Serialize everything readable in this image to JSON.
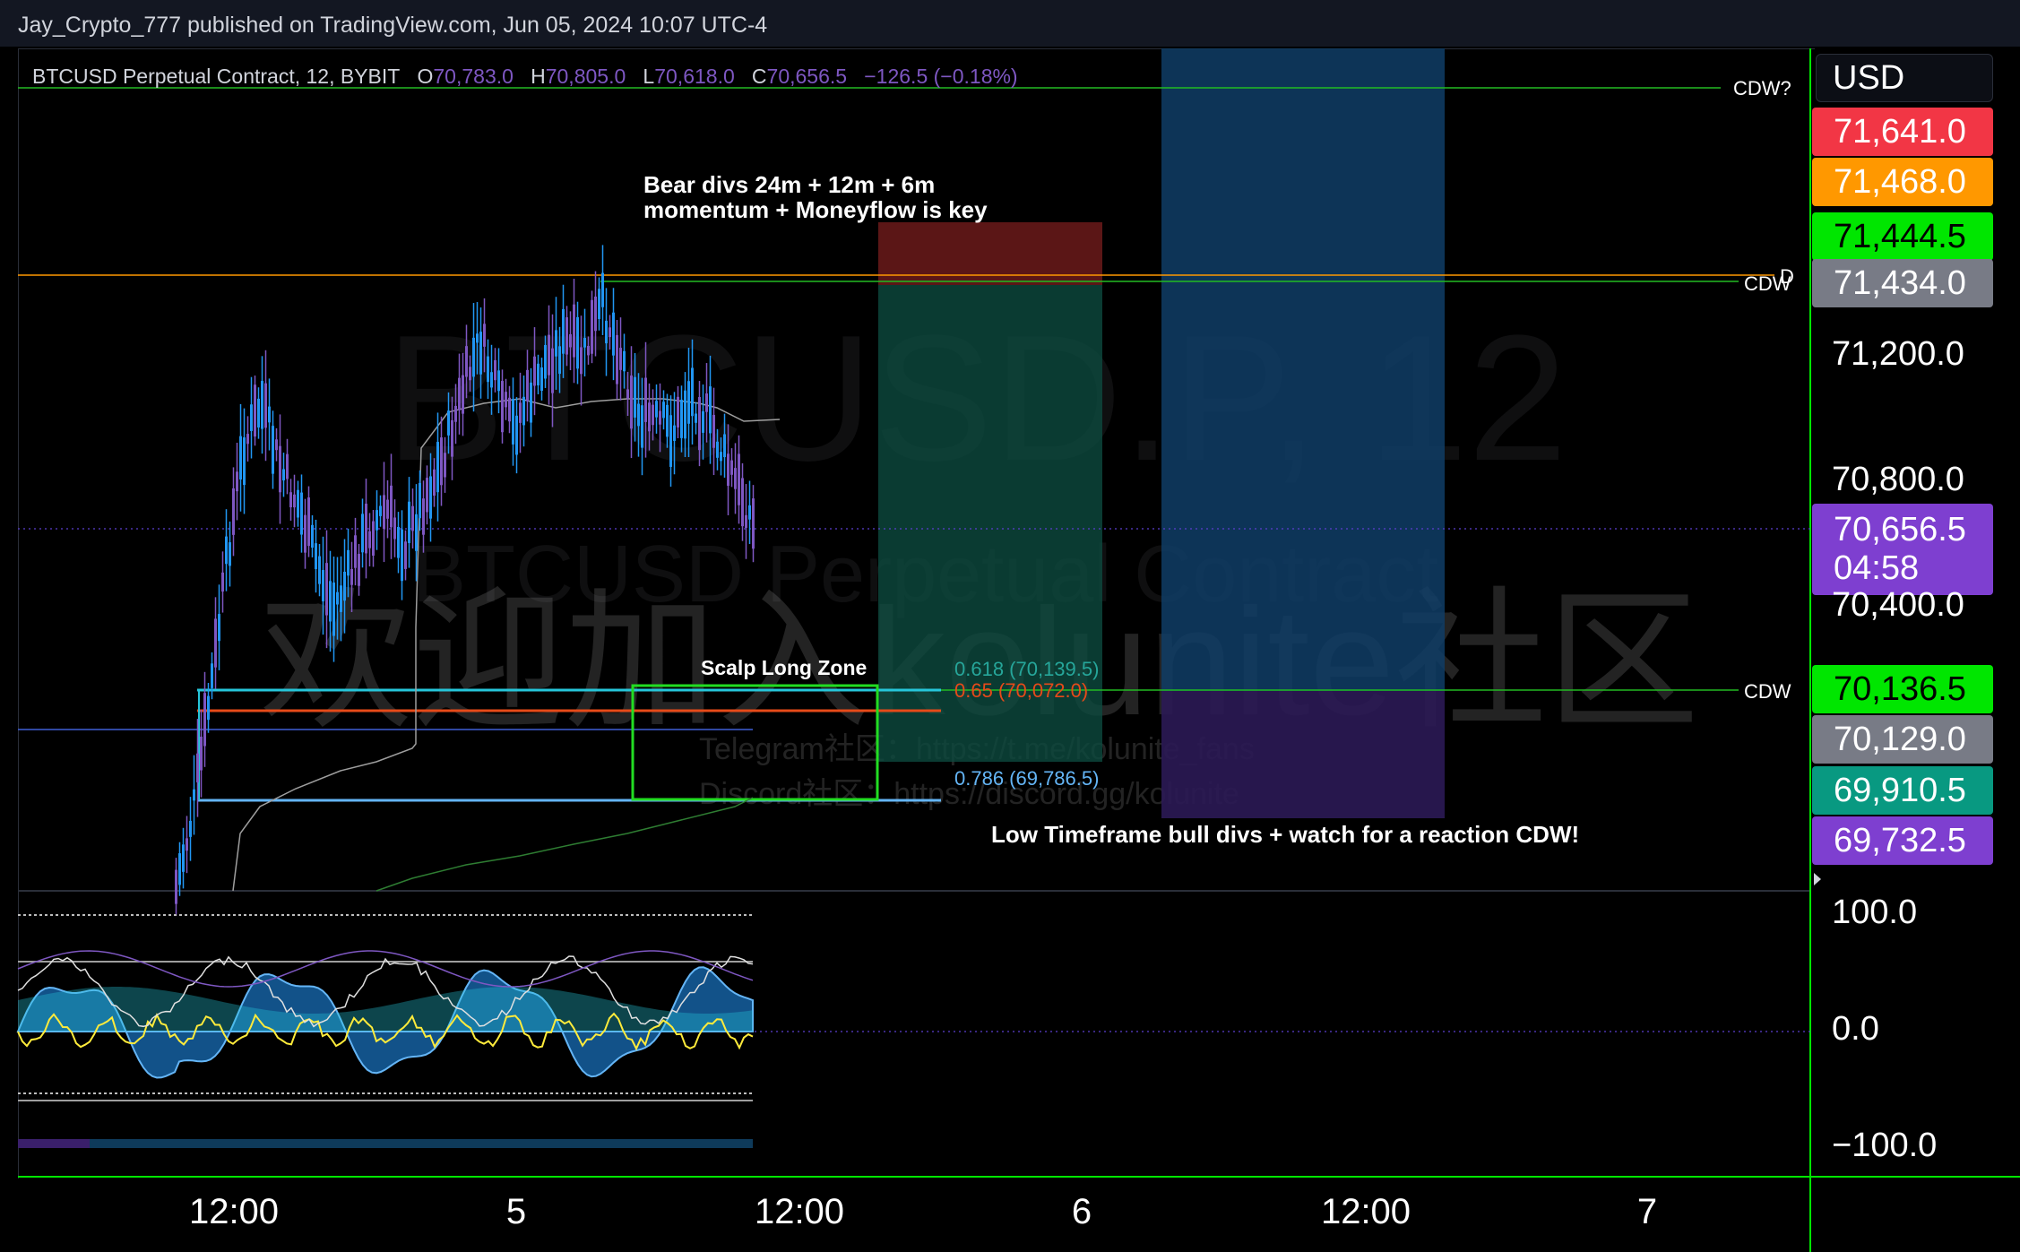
{
  "publish_line": "Jay_Crypto_777 published on TradingView.com, Jun 05, 2024 10:07 UTC-4",
  "symbol": {
    "name": "BTCUSD Perpetual Contract, 12, BYBIT",
    "o_label": "O",
    "o": "70,783.0",
    "h_label": "H",
    "h": "70,805.0",
    "l_label": "L",
    "l": "70,618.0",
    "c_label": "C",
    "c": "70,656.5",
    "change": "−126.5 (−0.18%)"
  },
  "currency": "USD",
  "watermark": {
    "big": "BTCUSD.P, 12",
    "sub": "BTCUSD Perpetual Contract",
    "cn": "欢迎加入kolunite社区",
    "telegram": "Telegram社区：https://t.me/kolunite_fans",
    "discord": "Discord社区：https://discord.gg/kolunite"
  },
  "notes": {
    "bear_line1": "Bear divs 24m + 12m + 6m",
    "bear_line2": "momentum + Moneyflow is key",
    "scalp": "Scalp Long Zone",
    "low_tf": "Low Timeframe bull divs + watch for a reaction CDW!"
  },
  "fib_labels": {
    "f618": "0.618 (70,139.5)",
    "f65": "0.65 (70,072.0)",
    "f786": "0.786 (69,786.5)"
  },
  "line_labels": {
    "cdw_top": "CDW?",
    "cdw_mid": "CDW",
    "d_mark": "D",
    "cdw_low": "CDW"
  },
  "price_tags": [
    {
      "value": "71,641.0",
      "color": "#f23645"
    },
    {
      "value": "71,468.0",
      "color": "#ff9800"
    },
    {
      "value": "71,444.5",
      "color": "#00e600"
    },
    {
      "value": "71,434.0",
      "color": "#787b86"
    },
    {
      "value": "70,656.5",
      "sub": "04:58",
      "color": "#7e3fd0"
    },
    {
      "value": "70,136.5",
      "color": "#00e600"
    },
    {
      "value": "70,129.0",
      "color": "#787b86"
    },
    {
      "value": "69,910.5",
      "color": "#089981"
    },
    {
      "value": "69,732.5",
      "color": "#7e3fd0"
    }
  ],
  "price_axis": [
    "71,200.0",
    "70,800.0",
    "70,400.0"
  ],
  "osc_axis": [
    "100.0",
    "0.0",
    "−100.0"
  ],
  "time_axis": [
    "12:00",
    "5",
    "12:00",
    "6",
    "12:00",
    "7"
  ],
  "colors": {
    "up": "#2196f3",
    "down": "#7e57c2",
    "long_profit": "#0d4a3f",
    "long_stop": "#6b1a1a",
    "projection": "#0f3d66",
    "projection_low": "#2b1a55",
    "scalp_box": "#22dd22"
  }
}
